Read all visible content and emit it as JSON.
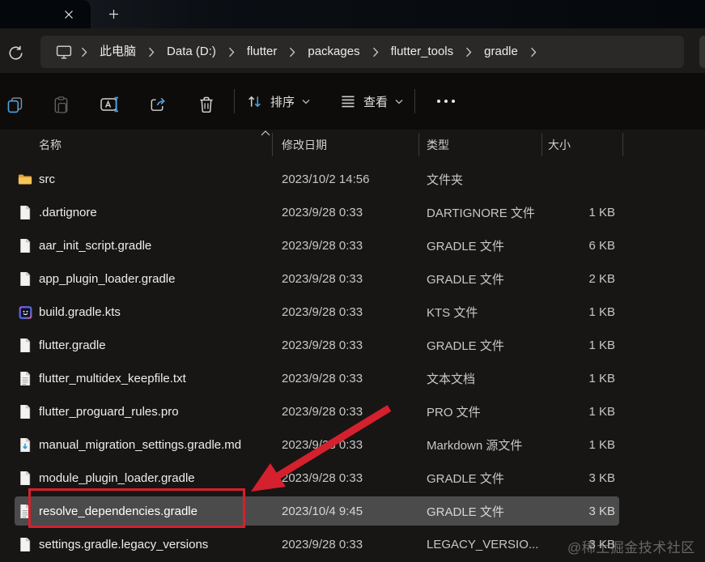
{
  "tabbar": {
    "close_icon": "close",
    "new_tab_icon": "plus"
  },
  "breadcrumb": {
    "device_icon": "monitor",
    "items": [
      "此电脑",
      "Data (D:)",
      "flutter",
      "packages",
      "flutter_tools",
      "gradle"
    ],
    "trailing_chevron": true
  },
  "toolbar": {
    "buttons": [
      "copy",
      "paste",
      "rename",
      "share",
      "delete"
    ],
    "paste_disabled": true,
    "sort_label": "排序",
    "view_label": "查看",
    "more_icon": "ellipsis"
  },
  "list": {
    "columns": [
      "名称",
      "修改日期",
      "类型",
      "大小"
    ],
    "sorted_column": "名称",
    "sort_ascending": true,
    "rows": [
      {
        "name": "src",
        "icon": "folder",
        "date": "2023/10/2 14:56",
        "type": "文件夹",
        "size": "",
        "selected": false
      },
      {
        "name": ".dartignore",
        "icon": "file",
        "date": "2023/9/28 0:33",
        "type": "DARTIGNORE 文件",
        "size": "1 KB",
        "selected": false
      },
      {
        "name": "aar_init_script.gradle",
        "icon": "file",
        "date": "2023/9/28 0:33",
        "type": "GRADLE 文件",
        "size": "6 KB",
        "selected": false
      },
      {
        "name": "app_plugin_loader.gradle",
        "icon": "file",
        "date": "2023/9/28 0:33",
        "type": "GRADLE 文件",
        "size": "2 KB",
        "selected": false
      },
      {
        "name": "build.gradle.kts",
        "icon": "file-kts",
        "date": "2023/9/28 0:33",
        "type": "KTS 文件",
        "size": "1 KB",
        "selected": false
      },
      {
        "name": "flutter.gradle",
        "icon": "file",
        "date": "2023/9/28 0:33",
        "type": "GRADLE 文件",
        "size": "1 KB",
        "selected": false
      },
      {
        "name": "flutter_multidex_keepfile.txt",
        "icon": "file-lines",
        "date": "2023/9/28 0:33",
        "type": "文本文档",
        "size": "1 KB",
        "selected": false
      },
      {
        "name": "flutter_proguard_rules.pro",
        "icon": "file",
        "date": "2023/9/28 0:33",
        "type": "PRO 文件",
        "size": "1 KB",
        "selected": false
      },
      {
        "name": "manual_migration_settings.gradle.md",
        "icon": "file-md",
        "date": "2023/9/28 0:33",
        "type": "Markdown 源文件",
        "size": "1 KB",
        "selected": false
      },
      {
        "name": "module_plugin_loader.gradle",
        "icon": "file",
        "date": "2023/9/28 0:33",
        "type": "GRADLE 文件",
        "size": "3 KB",
        "selected": false
      },
      {
        "name": "resolve_dependencies.gradle",
        "icon": "file-lines",
        "date": "2023/10/4 9:45",
        "type": "GRADLE 文件",
        "size": "3 KB",
        "selected": true
      },
      {
        "name": "settings.gradle.legacy_versions",
        "icon": "file",
        "date": "2023/9/28 0:33",
        "type": "LEGACY_VERSIO...",
        "size": "3 KB",
        "selected": false
      }
    ]
  },
  "annotations": {
    "highlight_color": "#d5202e",
    "watermark": "@稀土掘金技术社区"
  },
  "colors": {
    "accent_blue": "#4fa1df",
    "selection_gray": "#4b4b4b",
    "folder_yellow": "#f7c555"
  }
}
